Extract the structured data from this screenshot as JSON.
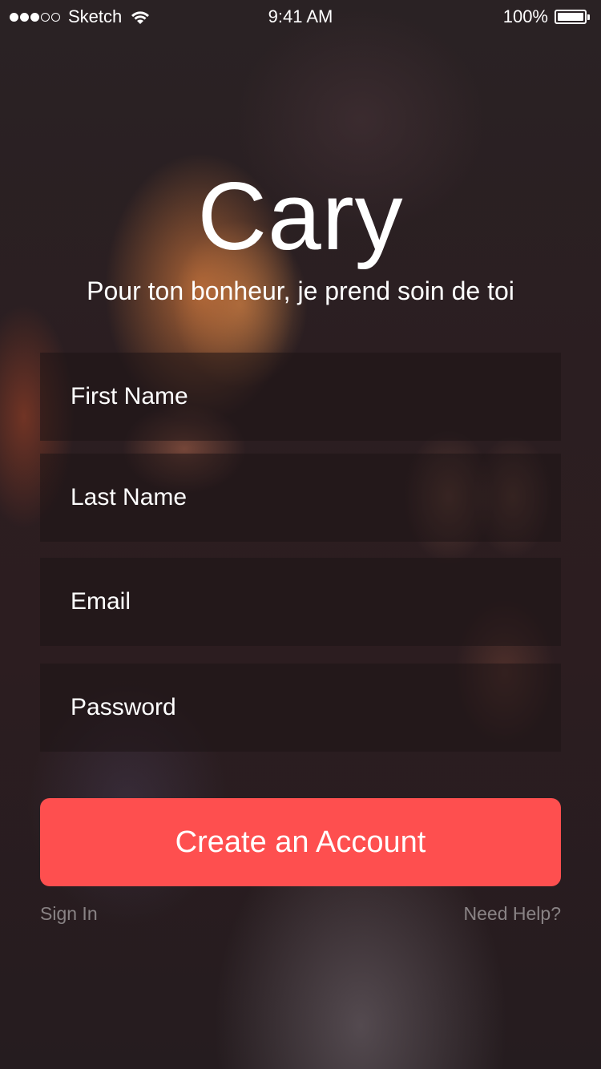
{
  "status_bar": {
    "carrier": "Sketch",
    "time": "9:41 AM",
    "battery": "100%",
    "signal_bars_filled": 3,
    "signal_bars_total": 5
  },
  "app": {
    "title": "Cary",
    "tagline": "Pour ton bonheur, je prend soin de toi"
  },
  "form": {
    "first_name_placeholder": "First Name",
    "last_name_placeholder": "Last Name",
    "email_placeholder": "Email",
    "password_placeholder": "Password",
    "first_name_value": "",
    "last_name_value": "",
    "email_value": "",
    "password_value": ""
  },
  "actions": {
    "create_account_label": "Create an Account",
    "sign_in_label": "Sign In",
    "need_help_label": "Need Help?"
  },
  "colors": {
    "accent": "#fe4f4f",
    "text": "#ffffff",
    "muted_link": "#8c8587"
  }
}
